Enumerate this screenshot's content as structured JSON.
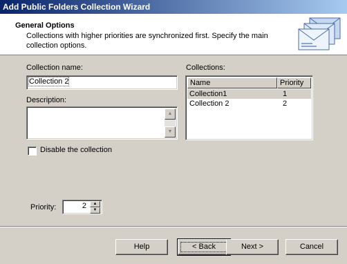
{
  "window": {
    "title": "Add Public Folders Collection Wizard"
  },
  "header": {
    "title": "General Options",
    "subtitle": "Collections with higher priorities are synchronized first. Specify the main collection options.",
    "icon": "envelopes-icon"
  },
  "form": {
    "collection_name_label": "Collection name:",
    "collection_name_value": "Collection 2",
    "description_label": "Description:",
    "description_value": "",
    "disable_label": "Disable the collection",
    "disable_checked": false,
    "priority_label": "Priority:",
    "priority_value": "2"
  },
  "collections": {
    "label": "Collections:",
    "columns": [
      "Name",
      "Priority"
    ],
    "rows": [
      {
        "name": "Collection1",
        "priority": "1",
        "selected": true
      },
      {
        "name": "Collection 2",
        "priority": "2",
        "selected": false
      }
    ]
  },
  "buttons": {
    "help": "Help",
    "back": "< Back",
    "next": "Next >",
    "cancel": "Cancel"
  }
}
